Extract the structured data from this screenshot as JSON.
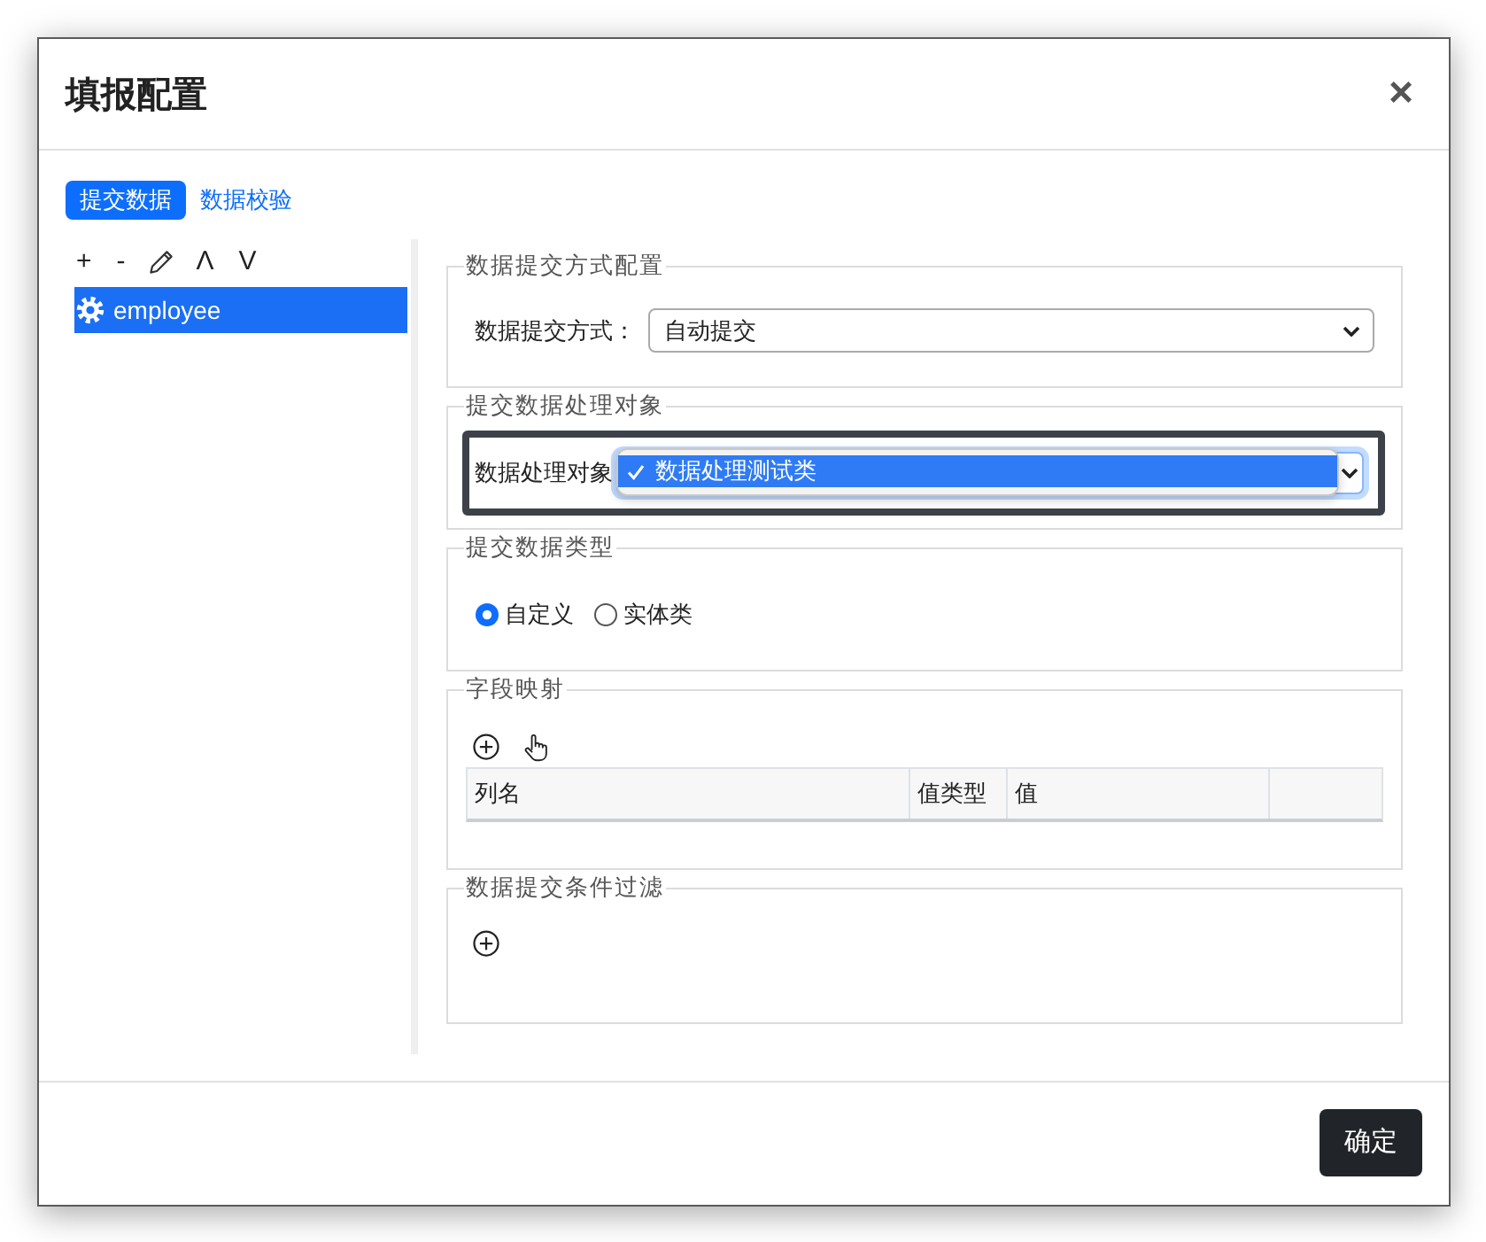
{
  "dialog": {
    "title": "填报配置",
    "close": "×"
  },
  "tabs": [
    {
      "label": "提交数据",
      "selected": true
    },
    {
      "label": "数据校验",
      "selected": false
    }
  ],
  "tree_toolbar": [
    {
      "kind": "add",
      "label": "+"
    },
    {
      "kind": "remove",
      "label": "-"
    },
    {
      "kind": "edit"
    },
    {
      "kind": "up",
      "label": "Λ"
    },
    {
      "kind": "down",
      "label": "V"
    }
  ],
  "tree": [
    {
      "label": "employee",
      "selected": true
    }
  ],
  "sections": [
    {
      "kind": "select",
      "legend": "数据提交方式配置",
      "label": "数据提交方式：",
      "value": "自动提交"
    },
    {
      "kind": "dropdown",
      "legend": "提交数据处理对象",
      "label": "数据处理对象",
      "options": [
        {
          "label": "数据处理测试类",
          "selected": true
        }
      ]
    },
    {
      "kind": "radio",
      "legend": "提交数据类型",
      "options": [
        {
          "label": "自定义",
          "selected": true
        },
        {
          "label": "实体类",
          "selected": false
        }
      ]
    },
    {
      "kind": "table",
      "legend": "字段映射",
      "columns": [
        "列名",
        "值类型",
        "值"
      ]
    },
    {
      "kind": "add",
      "legend": "数据提交条件过滤"
    }
  ],
  "footer": {
    "confirm": "确定"
  }
}
